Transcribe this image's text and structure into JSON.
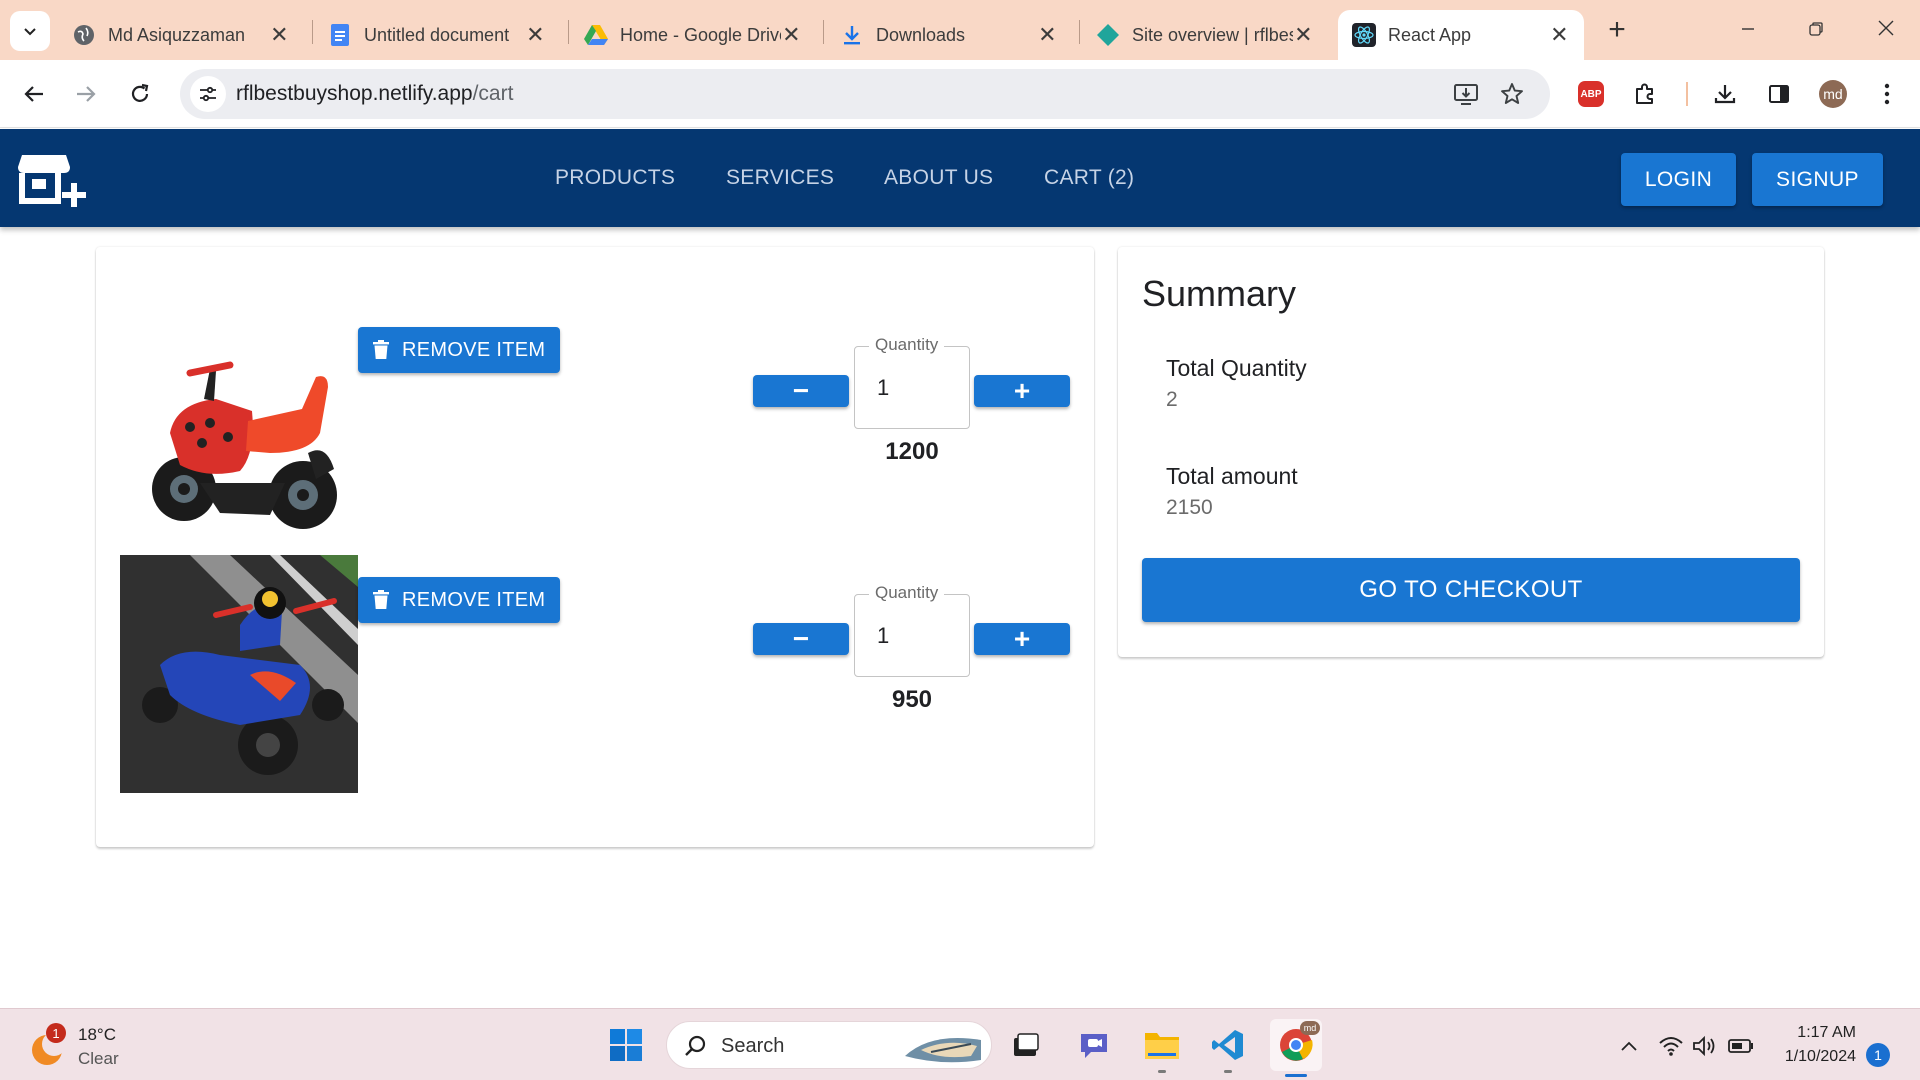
{
  "browser": {
    "tabs": [
      {
        "title": "Md Asiquzzaman",
        "icon": "globe-icon"
      },
      {
        "title": "Untitled document",
        "icon": "google-docs-icon"
      },
      {
        "title": "Home - Google Drive",
        "icon": "google-drive-icon"
      },
      {
        "title": "Downloads",
        "icon": "download-icon"
      },
      {
        "title": "Site overview | rflbestbuyshop",
        "icon": "netlify-icon"
      },
      {
        "title": "React App",
        "icon": "react-icon",
        "active": true
      }
    ],
    "new_tab": "+",
    "url_host": "rflbestbuyshop.netlify.app",
    "url_path": "/cart",
    "profile_initials": "md",
    "abp_label": "ABP"
  },
  "navbar": {
    "links": [
      "PRODUCTS",
      "SERVICES",
      "ABOUT US",
      "CART (2)"
    ],
    "login": "LOGIN",
    "signup": "SIGNUP",
    "bg_color": "#053771",
    "accent_color": "#1976d2"
  },
  "cart": {
    "items": [
      {
        "image": "red tricycle",
        "remove_label": "REMOVE ITEM",
        "quantity_label": "Quantity",
        "quantity": "1",
        "price": "1200",
        "minus": "−",
        "plus": "+"
      },
      {
        "image": "blue tricycle",
        "remove_label": "REMOVE ITEM",
        "quantity_label": "Quantity",
        "quantity": "1",
        "price": "950",
        "minus": "−",
        "plus": "+"
      }
    ]
  },
  "summary": {
    "title": "Summary",
    "total_quantity_label": "Total Quantity",
    "total_quantity": "2",
    "total_amount_label": "Total amount",
    "total_amount": "2150",
    "checkout": "GO TO CHECKOUT"
  },
  "taskbar": {
    "weather_temp": "18°C",
    "weather_cond": "Clear",
    "weather_badge": "1",
    "search": "Search",
    "time": "1:17 AM",
    "date": "1/10/2024",
    "notifications": "1",
    "chrome_badge": "md"
  }
}
